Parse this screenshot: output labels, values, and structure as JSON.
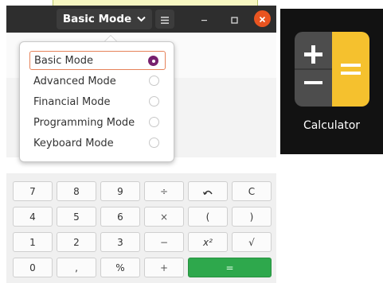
{
  "header": {
    "mode_label": "Basic Mode",
    "icons": [
      "chevron-down-icon",
      "hamburger-menu-icon",
      "minimize-icon",
      "maximize-icon",
      "close-icon"
    ],
    "colors": {
      "bar": "#2e2e2e",
      "close": "#e95420"
    }
  },
  "mode_menu": {
    "items": [
      {
        "label": "Basic Mode",
        "selected": true
      },
      {
        "label": "Advanced Mode",
        "selected": false
      },
      {
        "label": "Financial Mode",
        "selected": false
      },
      {
        "label": "Programming Mode",
        "selected": false
      },
      {
        "label": "Keyboard Mode",
        "selected": false
      }
    ],
    "colors": {
      "radio_checked": "#77216f",
      "selection_border": "#e6825a"
    }
  },
  "keypad": {
    "rows": [
      [
        "7",
        "8",
        "9",
        "÷",
        "undo-icon",
        "C"
      ],
      [
        "4",
        "5",
        "6",
        "×",
        "(",
        ")"
      ],
      [
        "1",
        "2",
        "3",
        "−",
        "x²",
        "√"
      ],
      [
        "0",
        ",",
        "%",
        "+",
        "="
      ]
    ],
    "colors": {
      "equals": "#2ea84c"
    }
  },
  "app": {
    "name": "Calculator",
    "icon": "calculator-app-icon",
    "colors": {
      "left": "#4d4d4d",
      "right": "#f5c12e"
    }
  }
}
